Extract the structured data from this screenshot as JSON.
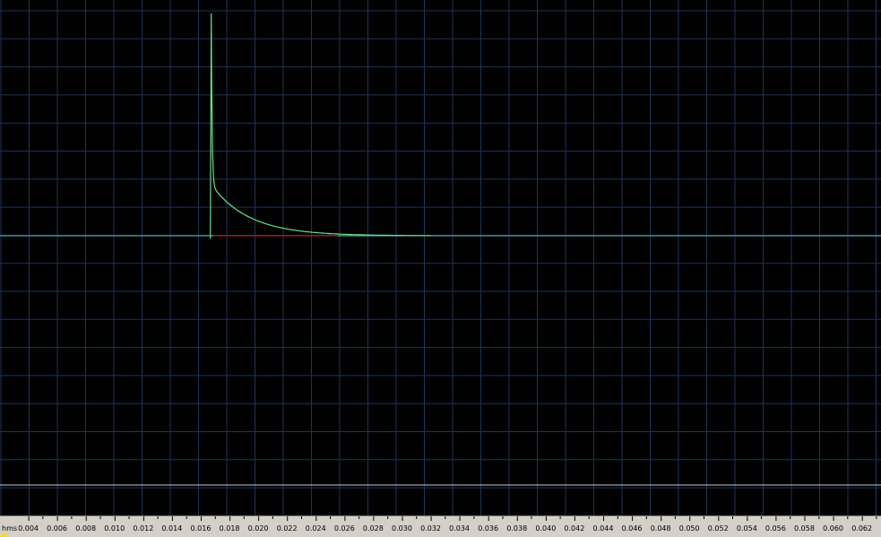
{
  "viewer": {
    "background": "#000000",
    "grid_color": "#1e3456",
    "baseline_color": "#40c8b0",
    "trace_color": "#66e08a",
    "residual_color": "#b02020",
    "marker_color": "#c8c8c8",
    "playhead_color": "#f0e000"
  },
  "ruler": {
    "unit_label": "hms",
    "ticks": [
      "0.004",
      "0.006",
      "0.008",
      "0.010",
      "0.012",
      "0.014",
      "0.016",
      "0.018",
      "0.020",
      "0.022",
      "0.024",
      "0.026",
      "0.028",
      "0.030",
      "0.032",
      "0.034",
      "0.036",
      "0.038",
      "0.040",
      "0.042",
      "0.044",
      "0.046",
      "0.048",
      "0.050",
      "0.052",
      "0.054",
      "0.056",
      "0.058",
      "0.060",
      "0.062"
    ]
  },
  "trace": {
    "x_start": 0.002,
    "x_end": 0.0633,
    "peak_time": 0.0167,
    "peak_level": 1.0,
    "settle_time": 0.032,
    "shape": "exponential-decay"
  }
}
